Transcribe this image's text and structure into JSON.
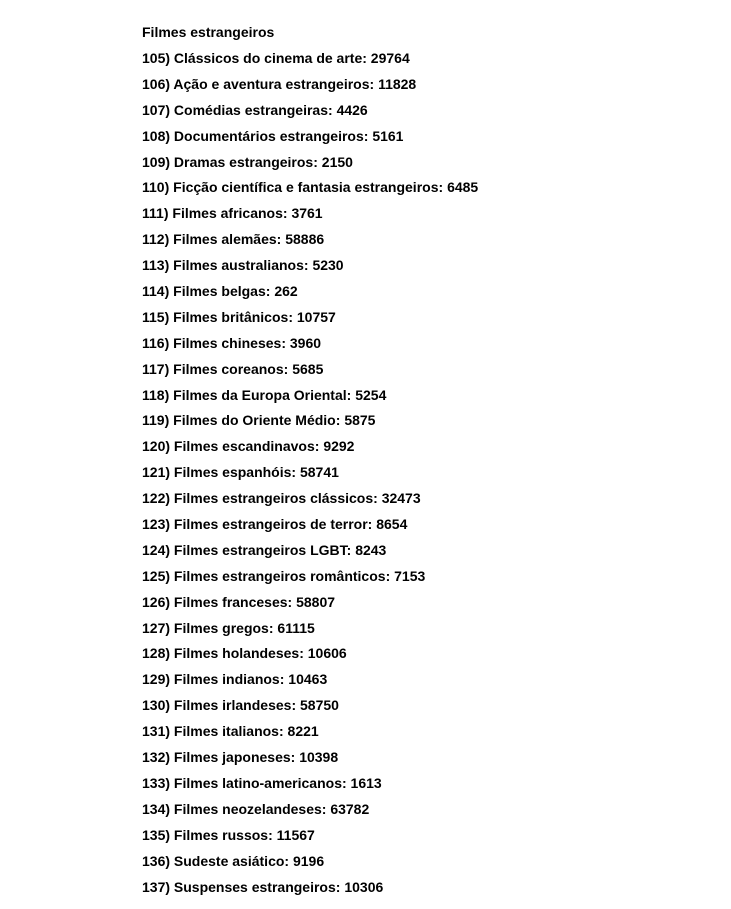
{
  "heading": "Filmes estrangeiros",
  "items": [
    {
      "num": "105",
      "label": "Clássicos do cinema de arte",
      "code": "29764"
    },
    {
      "num": "106",
      "label": "Ação e aventura estrangeiros",
      "code": "11828"
    },
    {
      "num": "107",
      "label": "Comédias estrangeiras",
      "code": "4426"
    },
    {
      "num": "108",
      "label": "Documentários estrangeiros",
      "code": "5161"
    },
    {
      "num": "109",
      "label": "Dramas estrangeiros",
      "code": "2150"
    },
    {
      "num": "110",
      "label": "Ficção científica e fantasia estrangeiros",
      "code": "6485"
    },
    {
      "num": "111",
      "label": "Filmes africanos",
      "code": "3761"
    },
    {
      "num": "112",
      "label": "Filmes alemães",
      "code": "58886"
    },
    {
      "num": "113",
      "label": "Filmes australianos",
      "code": "5230"
    },
    {
      "num": "114",
      "label": "Filmes belgas",
      "code": "262"
    },
    {
      "num": "115",
      "label": "Filmes britânicos",
      "code": "10757"
    },
    {
      "num": "116",
      "label": "Filmes chineses",
      "code": "3960"
    },
    {
      "num": "117",
      "label": "Filmes coreanos",
      "code": "5685"
    },
    {
      "num": "118",
      "label": "Filmes da Europa Oriental",
      "code": "5254"
    },
    {
      "num": "119",
      "label": "Filmes do Oriente Médio",
      "code": "5875"
    },
    {
      "num": "120",
      "label": "Filmes escandinavos",
      "code": "9292"
    },
    {
      "num": "121",
      "label": "Filmes espanhóis",
      "code": "58741"
    },
    {
      "num": "122",
      "label": "Filmes estrangeiros clássicos",
      "code": "32473"
    },
    {
      "num": "123",
      "label": "Filmes estrangeiros de terror",
      "code": "8654"
    },
    {
      "num": "124",
      "label": "Filmes estrangeiros LGBT",
      "code": "8243"
    },
    {
      "num": "125",
      "label": "Filmes estrangeiros românticos",
      "code": "7153"
    },
    {
      "num": "126",
      "label": "Filmes franceses",
      "code": "58807"
    },
    {
      "num": "127",
      "label": "Filmes gregos",
      "code": "61115"
    },
    {
      "num": "128",
      "label": "Filmes holandeses",
      "code": "10606"
    },
    {
      "num": "129",
      "label": "Filmes indianos",
      "code": "10463"
    },
    {
      "num": "130",
      "label": "Filmes irlandeses",
      "code": "58750"
    },
    {
      "num": "131",
      "label": "Filmes italianos",
      "code": "8221"
    },
    {
      "num": "132",
      "label": "Filmes japoneses",
      "code": "10398"
    },
    {
      "num": "133",
      "label": "Filmes latino-americanos",
      "code": "1613"
    },
    {
      "num": "134",
      "label": "Filmes neozelandeses",
      "code": "63782"
    },
    {
      "num": "135",
      "label": "Filmes russos",
      "code": "11567"
    },
    {
      "num": "136",
      "label": "Sudeste asiático",
      "code": "9196"
    },
    {
      "num": "137",
      "label": "Suspenses estrangeiros",
      "code": "10306"
    }
  ]
}
